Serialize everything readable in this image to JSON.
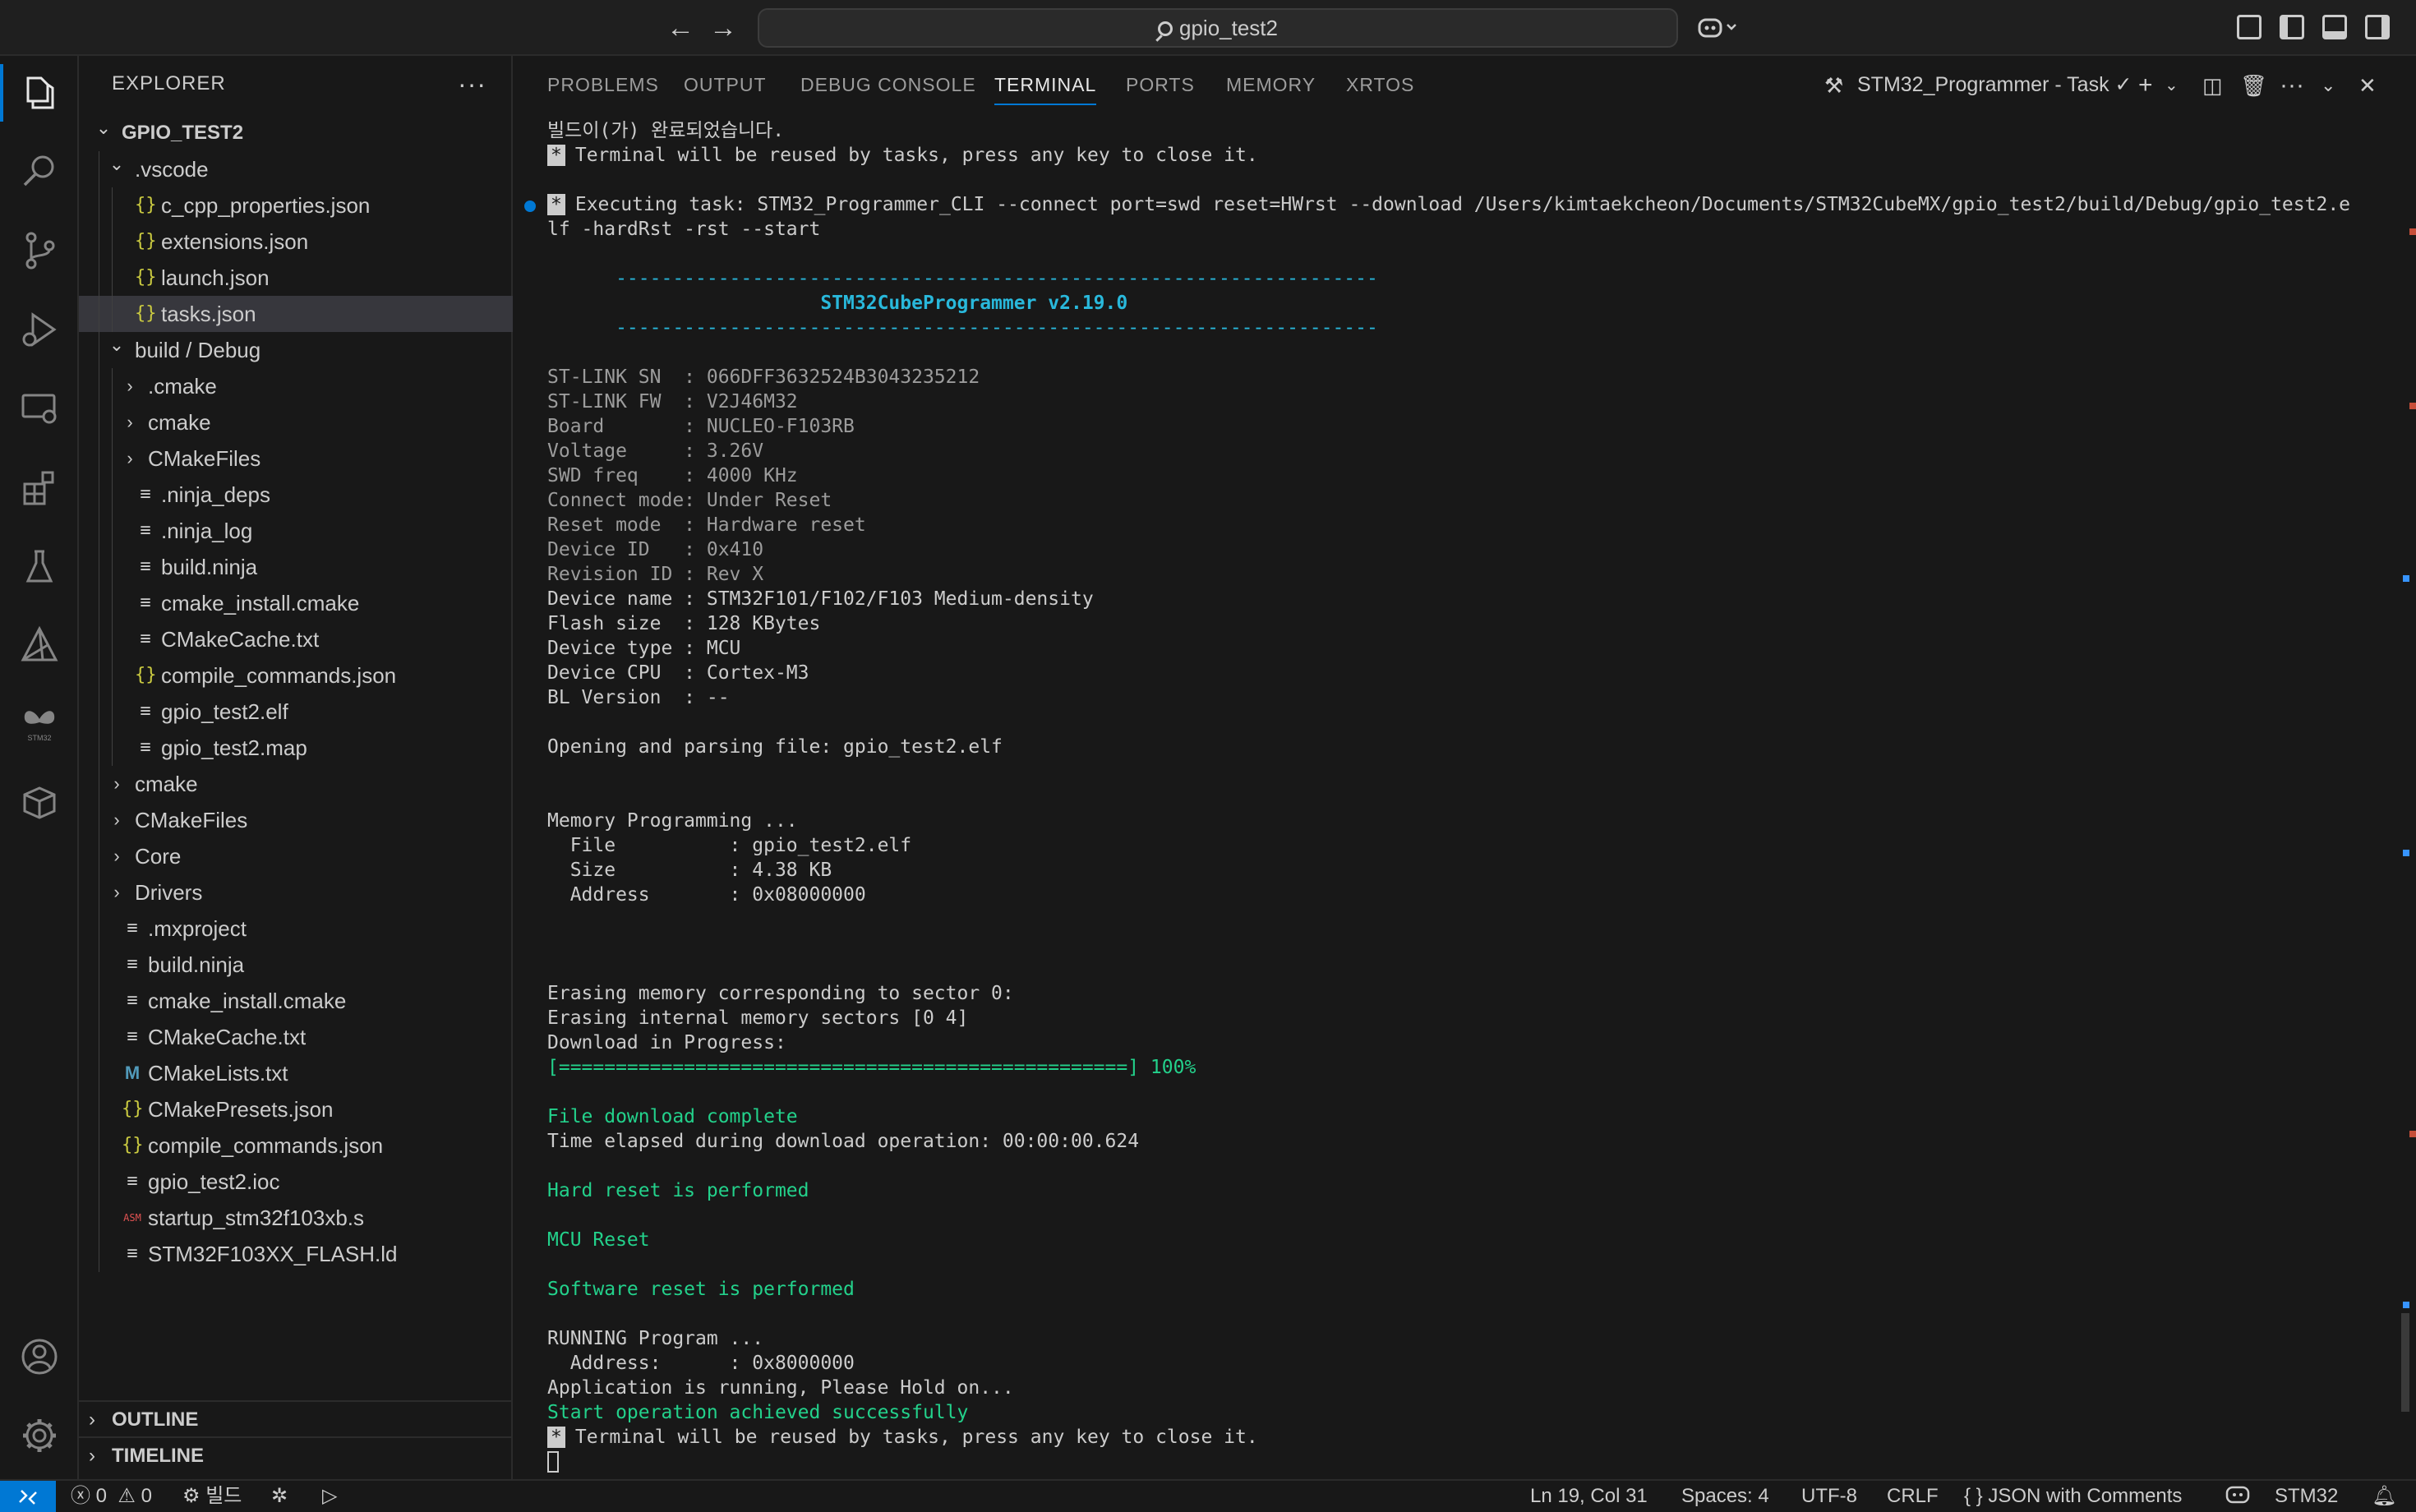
{
  "titlebar": {
    "search_text": "gpio_test2"
  },
  "sidebar": {
    "title": "EXPLORER",
    "more": "···",
    "tree": [
      {
        "label": "GPIO_TEST2",
        "depth": 0,
        "type": "root",
        "expanded": true
      },
      {
        "label": ".vscode",
        "depth": 1,
        "type": "folder",
        "expanded": true
      },
      {
        "label": "c_cpp_properties.json",
        "depth": 2,
        "type": "json"
      },
      {
        "label": "extensions.json",
        "depth": 2,
        "type": "json"
      },
      {
        "label": "launch.json",
        "depth": 2,
        "type": "json"
      },
      {
        "label": "tasks.json",
        "depth": 2,
        "type": "json",
        "selected": true
      },
      {
        "label": "build / Debug",
        "depth": 1,
        "type": "folder",
        "expanded": true
      },
      {
        "label": ".cmake",
        "depth": 2,
        "type": "folder",
        "expanded": false
      },
      {
        "label": "cmake",
        "depth": 2,
        "type": "folder",
        "expanded": false
      },
      {
        "label": "CMakeFiles",
        "depth": 2,
        "type": "folder",
        "expanded": false
      },
      {
        "label": ".ninja_deps",
        "depth": 2,
        "type": "file"
      },
      {
        "label": ".ninja_log",
        "depth": 2,
        "type": "file"
      },
      {
        "label": "build.ninja",
        "depth": 2,
        "type": "file"
      },
      {
        "label": "cmake_install.cmake",
        "depth": 2,
        "type": "file"
      },
      {
        "label": "CMakeCache.txt",
        "depth": 2,
        "type": "file"
      },
      {
        "label": "compile_commands.json",
        "depth": 2,
        "type": "json"
      },
      {
        "label": "gpio_test2.elf",
        "depth": 2,
        "type": "file"
      },
      {
        "label": "gpio_test2.map",
        "depth": 2,
        "type": "file"
      },
      {
        "label": "cmake",
        "depth": 1,
        "type": "folder",
        "expanded": false
      },
      {
        "label": "CMakeFiles",
        "depth": 1,
        "type": "folder",
        "expanded": false
      },
      {
        "label": "Core",
        "depth": 1,
        "type": "folder",
        "expanded": false
      },
      {
        "label": "Drivers",
        "depth": 1,
        "type": "folder",
        "expanded": false
      },
      {
        "label": ".mxproject",
        "depth": 1,
        "type": "file"
      },
      {
        "label": "build.ninja",
        "depth": 1,
        "type": "file"
      },
      {
        "label": "cmake_install.cmake",
        "depth": 1,
        "type": "file"
      },
      {
        "label": "CMakeCache.txt",
        "depth": 1,
        "type": "file"
      },
      {
        "label": "CMakeLists.txt",
        "depth": 1,
        "type": "m"
      },
      {
        "label": "CMakePresets.json",
        "depth": 1,
        "type": "json"
      },
      {
        "label": "compile_commands.json",
        "depth": 1,
        "type": "json"
      },
      {
        "label": "gpio_test2.ioc",
        "depth": 1,
        "type": "file"
      },
      {
        "label": "startup_stm32f103xb.s",
        "depth": 1,
        "type": "asm"
      },
      {
        "label": "STM32F103XX_FLASH.ld",
        "depth": 1,
        "type": "file"
      }
    ],
    "icon_glyphs": {
      "json": "{}",
      "file": "≡",
      "m": "M",
      "asm": "ASM"
    },
    "outline_label": "OUTLINE",
    "timeline_label": "TIMELINE"
  },
  "panel": {
    "tabs": [
      "PROBLEMS",
      "OUTPUT",
      "DEBUG CONSOLE",
      "TERMINAL",
      "PORTS",
      "MEMORY",
      "XRTOS"
    ],
    "active_tab": "TERMINAL",
    "task_name": "STM32_Programmer - Task ✓",
    "terminal_lines": [
      {
        "text": "빌드이(가) 완료되었습니다.",
        "style": "normal"
      },
      {
        "text": "Terminal will be reused by tasks, press any key to close it.",
        "style": "normal",
        "star": true
      },
      {
        "text": "",
        "style": "normal"
      },
      {
        "text": "Executing task: STM32_Programmer_CLI --connect port=swd reset=HWrst --download /Users/kimtaekcheon/Documents/STM32CubeMX/gpio_test2/build/Debug/gpio_test2.e",
        "style": "normal",
        "star": true,
        "dot": true
      },
      {
        "text": "lf -hardRst -rst --start",
        "style": "normal"
      },
      {
        "text": "",
        "style": "normal"
      },
      {
        "text": "      -------------------------------------------------------------------",
        "style": "rule"
      },
      {
        "text": "                        STM32CubeProgrammer v2.19.0",
        "style": "cyan"
      },
      {
        "text": "      -------------------------------------------------------------------",
        "style": "rule"
      },
      {
        "text": "",
        "style": "normal"
      },
      {
        "text": "ST-LINK SN  : 066DFF3632524B3043235212",
        "style": "dim"
      },
      {
        "text": "ST-LINK FW  : V2J46M32",
        "style": "dim"
      },
      {
        "text": "Board       : NUCLEO-F103RB",
        "style": "dim"
      },
      {
        "text": "Voltage     : 3.26V",
        "style": "dim"
      },
      {
        "text": "SWD freq    : 4000 KHz",
        "style": "dim"
      },
      {
        "text": "Connect mode: Under Reset",
        "style": "dim"
      },
      {
        "text": "Reset mode  : Hardware reset",
        "style": "dim"
      },
      {
        "text": "Device ID   : 0x410",
        "style": "dim"
      },
      {
        "text": "Revision ID : Rev X",
        "style": "dim"
      },
      {
        "text": "Device name : STM32F101/F102/F103 Medium-density",
        "style": "normal"
      },
      {
        "text": "Flash size  : 128 KBytes",
        "style": "normal"
      },
      {
        "text": "Device type : MCU",
        "style": "normal"
      },
      {
        "text": "Device CPU  : Cortex-M3",
        "style": "normal"
      },
      {
        "text": "BL Version  : --",
        "style": "normal"
      },
      {
        "text": "",
        "style": "normal"
      },
      {
        "text": "Opening and parsing file: gpio_test2.elf",
        "style": "normal"
      },
      {
        "text": "",
        "style": "normal"
      },
      {
        "text": "",
        "style": "normal"
      },
      {
        "text": "Memory Programming ...",
        "style": "normal"
      },
      {
        "text": "  File          : gpio_test2.elf",
        "style": "normal"
      },
      {
        "text": "  Size          : 4.38 KB",
        "style": "normal"
      },
      {
        "text": "  Address       : 0x08000000",
        "style": "normal"
      },
      {
        "text": "",
        "style": "normal"
      },
      {
        "text": "",
        "style": "normal"
      },
      {
        "text": "",
        "style": "normal"
      },
      {
        "text": "Erasing memory corresponding to sector 0:",
        "style": "normal"
      },
      {
        "text": "Erasing internal memory sectors [0 4]",
        "style": "normal"
      },
      {
        "text": "Download in Progress:",
        "style": "normal"
      },
      {
        "text": "[==================================================] 100%",
        "style": "green"
      },
      {
        "text": "",
        "style": "normal"
      },
      {
        "text": "File download complete",
        "style": "green"
      },
      {
        "text": "Time elapsed during download operation: 00:00:00.624",
        "style": "normal"
      },
      {
        "text": "",
        "style": "normal"
      },
      {
        "text": "Hard reset is performed",
        "style": "green"
      },
      {
        "text": "",
        "style": "normal"
      },
      {
        "text": "MCU Reset",
        "style": "green"
      },
      {
        "text": "",
        "style": "normal"
      },
      {
        "text": "Software reset is performed",
        "style": "green"
      },
      {
        "text": "",
        "style": "normal"
      },
      {
        "text": "RUNNING Program ...",
        "style": "normal"
      },
      {
        "text": "  Address:      : 0x8000000",
        "style": "normal"
      },
      {
        "text": "Application is running, Please Hold on...",
        "style": "normal"
      },
      {
        "text": "Start operation achieved successfully",
        "style": "green"
      },
      {
        "text": "Terminal will be reused by tasks, press any key to close it.",
        "style": "normal",
        "star": true
      }
    ]
  },
  "statusbar": {
    "errors": "0",
    "warnings": "0",
    "build_label": "빌드",
    "cursor_position": "Ln 19, Col 31",
    "spaces": "Spaces: 4",
    "encoding": "UTF-8",
    "eol": "CRLF",
    "language": "JSON with Comments",
    "target": "STM32"
  },
  "colors": {
    "accent": "#0078d4",
    "terminal_green": "#23d18b",
    "terminal_cyan": "#29b8db",
    "json_icon": "#cbcb41"
  }
}
